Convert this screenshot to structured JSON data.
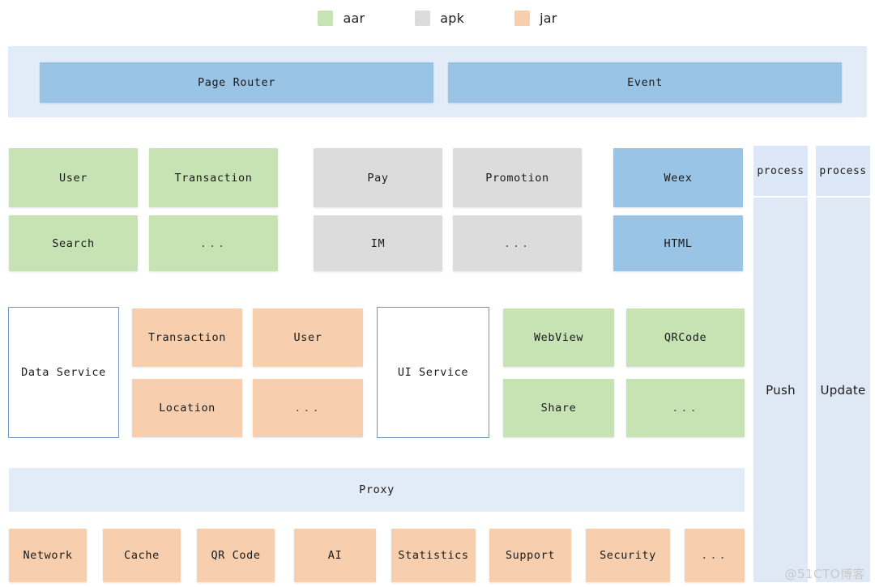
{
  "legend": {
    "items": [
      {
        "label": "aar",
        "color": "#c7e3b3",
        "icon": "square-swatch-icon"
      },
      {
        "label": "apk",
        "color": "#dcdcdc",
        "icon": "square-swatch-icon"
      },
      {
        "label": "jar",
        "color": "#f8cfae",
        "icon": "square-swatch-icon"
      }
    ]
  },
  "layers": {
    "top_band": {
      "boxes": [
        {
          "label": "Page Router",
          "type": "blue"
        },
        {
          "label": "Event",
          "type": "blue"
        }
      ]
    },
    "business_layer": {
      "groups": [
        {
          "name": "account-group",
          "type": "aar",
          "cells": [
            [
              "User",
              "Transaction"
            ],
            [
              "Search",
              "..."
            ]
          ]
        },
        {
          "name": "app-group",
          "type": "apk",
          "cells": [
            [
              "Pay",
              "Promotion"
            ],
            [
              "IM",
              "..."
            ]
          ]
        },
        {
          "name": "container-group",
          "type": "blue",
          "cells": [
            [
              "Weex"
            ],
            [
              "HTML"
            ]
          ]
        }
      ]
    },
    "service_layer": {
      "data_service": {
        "label": "Data Service",
        "type": "outline"
      },
      "data_modules": {
        "type": "jar",
        "cells": [
          [
            "Transaction",
            "User"
          ],
          [
            "Location",
            "..."
          ]
        ]
      },
      "ui_service": {
        "label": "UI Service",
        "type": "outline"
      },
      "ui_modules": {
        "type": "aar",
        "cells": [
          [
            "WebView",
            "QRCode"
          ],
          [
            "Share",
            "..."
          ]
        ]
      }
    },
    "proxy_band": {
      "label": "Proxy"
    },
    "foundation_layer": {
      "type": "jar",
      "cells": [
        "Network",
        "Cache",
        "QR Code",
        "AI",
        "Statistics",
        "Support",
        "Security",
        "..."
      ]
    },
    "process_columns": [
      {
        "header": "process",
        "label": "Push"
      },
      {
        "header": "process",
        "label": "Update"
      }
    ]
  },
  "watermark": {
    "text": "@51CTO博客"
  }
}
